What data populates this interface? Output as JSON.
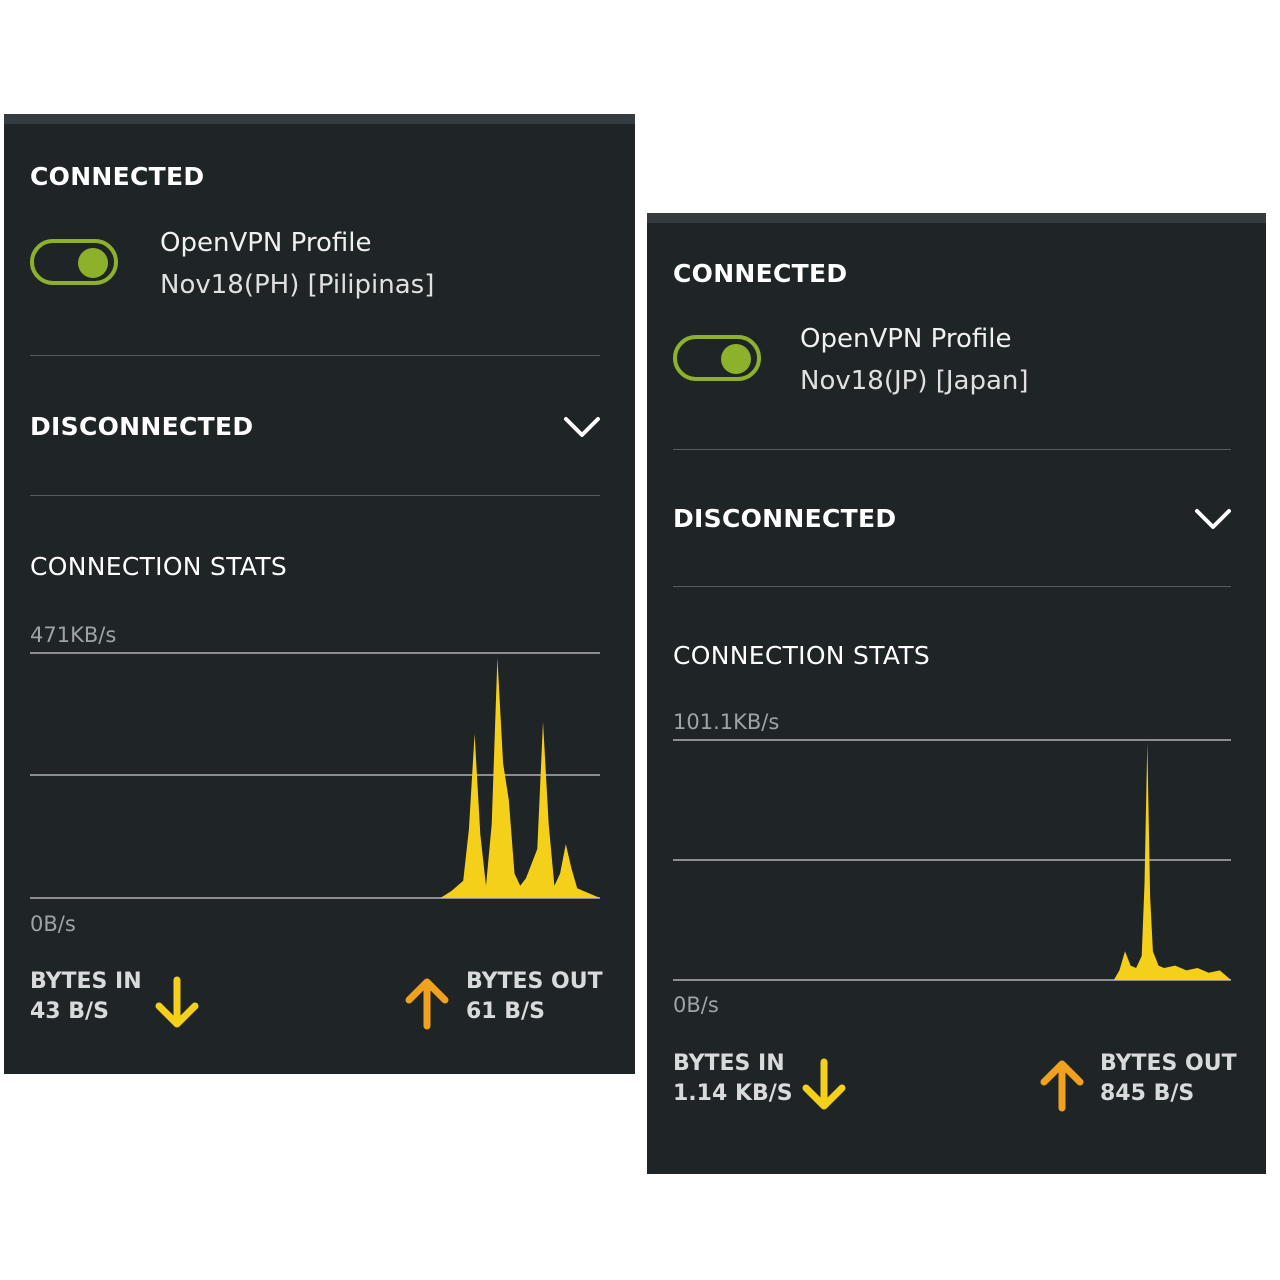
{
  "panels": [
    {
      "connected_title": "CONNECTED",
      "profile_name": "OpenVPN Profile",
      "profile_server": "Nov18(PH) [Pilipinas]",
      "toggle_on": true,
      "disconnected_title": "DISCONNECTED",
      "stats_title": "CONNECTION STATS",
      "max_rate": "471KB/s",
      "min_rate": "0B/s",
      "bytes_in_label": "BYTES IN",
      "bytes_in_value": "43 B/S",
      "bytes_out_label": "BYTES OUT",
      "bytes_out_value": "61 B/S",
      "chart_peaks": [
        [
          0.0,
          0.0
        ],
        [
          0.72,
          0.0
        ],
        [
          0.74,
          0.03
        ],
        [
          0.76,
          0.07
        ],
        [
          0.77,
          0.28
        ],
        [
          0.78,
          0.67
        ],
        [
          0.79,
          0.26
        ],
        [
          0.8,
          0.05
        ],
        [
          0.81,
          0.3
        ],
        [
          0.82,
          0.98
        ],
        [
          0.83,
          0.55
        ],
        [
          0.84,
          0.4
        ],
        [
          0.85,
          0.1
        ],
        [
          0.86,
          0.05
        ],
        [
          0.87,
          0.08
        ],
        [
          0.88,
          0.14
        ],
        [
          0.89,
          0.2
        ],
        [
          0.9,
          0.72
        ],
        [
          0.91,
          0.3
        ],
        [
          0.92,
          0.05
        ],
        [
          0.93,
          0.1
        ],
        [
          0.94,
          0.22
        ],
        [
          0.95,
          0.12
        ],
        [
          0.96,
          0.04
        ],
        [
          0.97,
          0.03
        ],
        [
          0.98,
          0.02
        ],
        [
          1.0,
          0.0
        ]
      ]
    },
    {
      "connected_title": "CONNECTED",
      "profile_name": "OpenVPN Profile",
      "profile_server": "Nov18(JP) [Japan]",
      "toggle_on": true,
      "disconnected_title": "DISCONNECTED",
      "stats_title": "CONNECTION STATS",
      "max_rate": "101.1KB/s",
      "min_rate": "0B/s",
      "bytes_in_label": "BYTES IN",
      "bytes_in_value": "1.14 KB/S",
      "bytes_out_label": "BYTES OUT",
      "bytes_out_value": "845 B/S",
      "chart_peaks": [
        [
          0.0,
          0.0
        ],
        [
          0.79,
          0.0
        ],
        [
          0.8,
          0.04
        ],
        [
          0.81,
          0.12
        ],
        [
          0.82,
          0.06
        ],
        [
          0.83,
          0.05
        ],
        [
          0.84,
          0.1
        ],
        [
          0.845,
          0.4
        ],
        [
          0.85,
          0.99
        ],
        [
          0.855,
          0.35
        ],
        [
          0.86,
          0.12
        ],
        [
          0.87,
          0.06
        ],
        [
          0.88,
          0.05
        ],
        [
          0.9,
          0.06
        ],
        [
          0.92,
          0.04
        ],
        [
          0.94,
          0.05
        ],
        [
          0.96,
          0.03
        ],
        [
          0.98,
          0.04
        ],
        [
          1.0,
          0.0
        ]
      ]
    }
  ],
  "colors": {
    "panel_bg": "#1f2427",
    "toggle_green": "#8db12a",
    "chart_yellow": "#f5d01b",
    "arrow_in": "#f5d01b",
    "arrow_out": "#f0a21e"
  }
}
